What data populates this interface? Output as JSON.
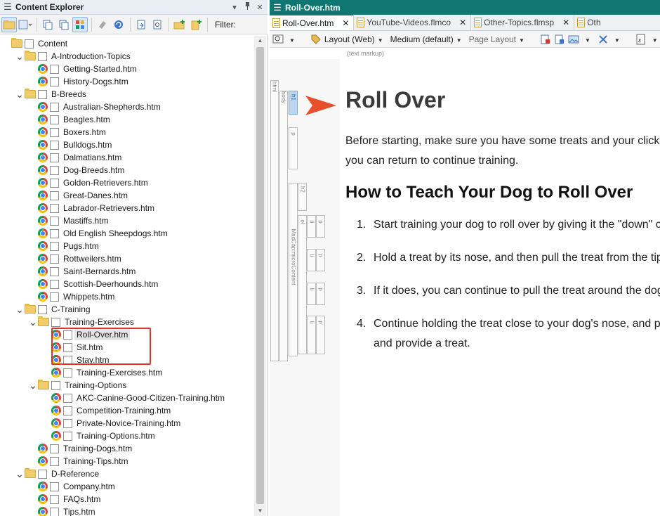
{
  "left_panel": {
    "title": "Content Explorer",
    "title_buttons": [
      "▾",
      "📌",
      "✕"
    ],
    "toolbar": {
      "filter_label": "Filter:"
    },
    "tree": [
      {
        "depth": 0,
        "kind": "folder",
        "expanded": null,
        "label": "Content"
      },
      {
        "depth": 1,
        "kind": "folder",
        "expanded": true,
        "label": "A-Introduction-Topics"
      },
      {
        "depth": 2,
        "kind": "file",
        "label": "Getting-Started.htm"
      },
      {
        "depth": 2,
        "kind": "file",
        "label": "History-Dogs.htm"
      },
      {
        "depth": 1,
        "kind": "folder",
        "expanded": true,
        "label": "B-Breeds"
      },
      {
        "depth": 2,
        "kind": "file",
        "label": "Australian-Shepherds.htm"
      },
      {
        "depth": 2,
        "kind": "file",
        "label": "Beagles.htm"
      },
      {
        "depth": 2,
        "kind": "file",
        "label": "Boxers.htm"
      },
      {
        "depth": 2,
        "kind": "file",
        "label": "Bulldogs.htm"
      },
      {
        "depth": 2,
        "kind": "file",
        "label": "Dalmatians.htm"
      },
      {
        "depth": 2,
        "kind": "file",
        "label": "Dog-Breeds.htm"
      },
      {
        "depth": 2,
        "kind": "file",
        "label": "Golden-Retrievers.htm"
      },
      {
        "depth": 2,
        "kind": "file",
        "label": "Great-Danes.htm"
      },
      {
        "depth": 2,
        "kind": "file",
        "label": "Labrador-Retrievers.htm"
      },
      {
        "depth": 2,
        "kind": "file",
        "label": "Mastiffs.htm"
      },
      {
        "depth": 2,
        "kind": "file",
        "label": "Old English Sheepdogs.htm"
      },
      {
        "depth": 2,
        "kind": "file",
        "label": "Pugs.htm"
      },
      {
        "depth": 2,
        "kind": "file",
        "label": "Rottweilers.htm"
      },
      {
        "depth": 2,
        "kind": "file",
        "label": "Saint-Bernards.htm"
      },
      {
        "depth": 2,
        "kind": "file",
        "label": "Scottish-Deerhounds.htm"
      },
      {
        "depth": 2,
        "kind": "file",
        "label": "Whippets.htm"
      },
      {
        "depth": 1,
        "kind": "folder",
        "expanded": true,
        "label": "C-Training"
      },
      {
        "depth": 2,
        "kind": "folder",
        "expanded": true,
        "label": "Training-Exercises"
      },
      {
        "depth": 3,
        "kind": "file",
        "label": "Roll-Over.htm",
        "selected": true
      },
      {
        "depth": 3,
        "kind": "file",
        "label": "Sit.htm"
      },
      {
        "depth": 3,
        "kind": "file",
        "label": "Stay.htm"
      },
      {
        "depth": 3,
        "kind": "file",
        "label": "Training-Exercises.htm"
      },
      {
        "depth": 2,
        "kind": "folder",
        "expanded": true,
        "label": "Training-Options"
      },
      {
        "depth": 3,
        "kind": "file",
        "label": "AKC-Canine-Good-Citizen-Training.htm"
      },
      {
        "depth": 3,
        "kind": "file",
        "label": "Competition-Training.htm"
      },
      {
        "depth": 3,
        "kind": "file",
        "label": "Private-Novice-Training.htm"
      },
      {
        "depth": 3,
        "kind": "file",
        "label": "Training-Options.htm"
      },
      {
        "depth": 2,
        "kind": "file",
        "label": "Training-Dogs.htm"
      },
      {
        "depth": 2,
        "kind": "file",
        "label": "Training-Tips.htm"
      },
      {
        "depth": 1,
        "kind": "folder",
        "expanded": true,
        "label": "D-Reference"
      },
      {
        "depth": 2,
        "kind": "file",
        "label": "Company.htm"
      },
      {
        "depth": 2,
        "kind": "file",
        "label": "FAQs.htm"
      },
      {
        "depth": 2,
        "kind": "file",
        "label": "Tips.htm"
      }
    ]
  },
  "right_panel": {
    "title": "Roll-Over.htm",
    "tabs": [
      {
        "label": "Roll-Over.htm",
        "active": true,
        "close": "✕"
      },
      {
        "label": "YouTube-Videos.flmco",
        "active": false,
        "close": "✕"
      },
      {
        "label": "Other-Topics.flmsp",
        "active": false,
        "close": "✕"
      },
      {
        "label": "Oth",
        "active": false,
        "close": ""
      }
    ],
    "toolbar": {
      "layout": "Layout (Web)",
      "medium": "Medium (default)",
      "page_layout": "Page Layout"
    },
    "text_markup_note": "(text markup)",
    "structure_labels": {
      "html": "html",
      "body": "body",
      "h1": "h1",
      "p": "p",
      "h2": "h2",
      "div": "MadCap:microContent",
      "ol": "ol",
      "li": "li",
      "p2": "p"
    },
    "document": {
      "h1": "Roll Over",
      "intro": "Before starting, make sure you have some treats and your clicker ready. When you can return to continue training.",
      "h2": "How to Teach Your Dog to Roll Over",
      "steps": [
        {
          "num": "1.",
          "text": "Start training your dog to roll over by giving it the \"down\" command."
        },
        {
          "num": "2.",
          "text": "Hold a treat by its nose, and then pull the treat from the tip of its nose."
        },
        {
          "num": "3.",
          "text": "If it does, you can continue to pull the treat around the dog's body."
        },
        {
          "num": "4.",
          "text": "Continue holding the treat close to your dog's nose, and praise it.",
          "more": "and provide a treat."
        }
      ]
    }
  },
  "colors": {
    "accent_teal": "#0f7672",
    "highlight_red": "#d8372e",
    "arrow_orange": "#e8502b"
  }
}
